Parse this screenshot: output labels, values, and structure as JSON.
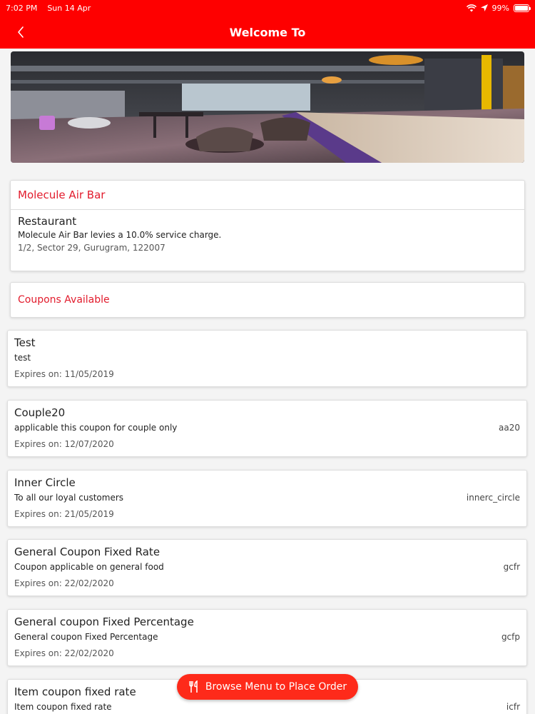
{
  "status_bar": {
    "time": "7:02 PM",
    "date": "Sun 14 Apr",
    "battery": "99%",
    "battery_level": 0.99
  },
  "nav": {
    "title": "Welcome To",
    "back_icon": "chevron-left-icon"
  },
  "hero": {
    "icon": "restaurant-photo"
  },
  "restaurant": {
    "name": "Molecule Air Bar",
    "type": "Restaurant",
    "service_note": "Molecule Air Bar levies a 10.0% service charge.",
    "address": "1/2, Sector 29, Gurugram, 122007"
  },
  "coupons_header": "Coupons Available",
  "coupons": [
    {
      "title": "Test",
      "description": "test",
      "code": "",
      "expiry": "Expires on: 11/05/2019"
    },
    {
      "title": "Couple20",
      "description": "applicable this coupon for couple only",
      "code": "aa20",
      "expiry": "Expires on: 12/07/2020"
    },
    {
      "title": "Inner Circle",
      "description": "To all our loyal customers",
      "code": "innerc_circle",
      "expiry": "Expires on: 21/05/2019"
    },
    {
      "title": "General Coupon Fixed Rate",
      "description": "Coupon applicable on general food",
      "code": "gcfr",
      "expiry": "Expires on: 22/02/2020"
    },
    {
      "title": "General coupon Fixed Percentage",
      "description": "General coupon Fixed Percentage",
      "code": "gcfp",
      "expiry": "Expires on: 22/02/2020"
    },
    {
      "title": "Item coupon fixed rate",
      "description": "Item coupon fixed rate",
      "code": "icfr",
      "expiry": ""
    }
  ],
  "browse_button": {
    "label": "Browse Menu to Place Order",
    "icon": "fork-knife-icon"
  },
  "colors": {
    "accent": "#fe0000",
    "heading": "#e21b2c"
  }
}
